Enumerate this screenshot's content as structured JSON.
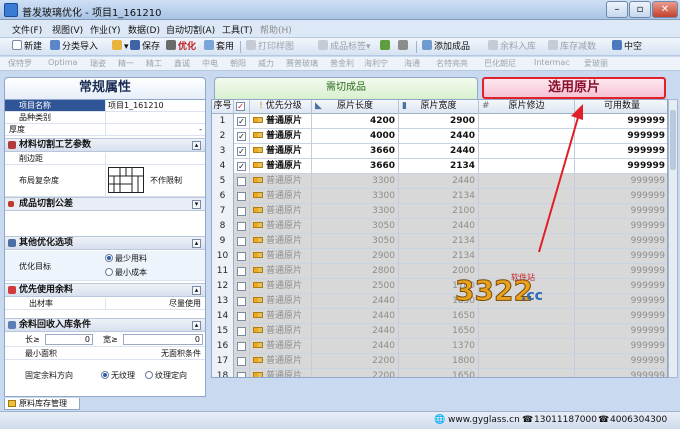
{
  "window": {
    "title": "普发玻璃优化 - 项目1_161210",
    "min": "–",
    "max": "▫",
    "close": "✕"
  },
  "menu": [
    "文件(F)",
    "视图(V)",
    "作业(Y)",
    "数据(D)",
    "自动切割(A)",
    "工具(T)",
    "帮助(H)"
  ],
  "toolbar": {
    "new": "新建",
    "import": "分类导入",
    "save": "保存",
    "optimize": "优化",
    "apply": "套用",
    "print": "打印样图",
    "label": "成品标签",
    "add": "添加成品",
    "inbound": "余料入库",
    "inventory": "库存减数",
    "hollow": "中空"
  },
  "brands": [
    "保特罗",
    "Optima",
    "瑞姿",
    "精一",
    "精工",
    "鑫诚",
    "中电",
    "朝阳",
    "威力",
    "赛普玻璃",
    "普金利",
    "海利宁",
    "海通",
    "名特亮亮",
    "巴化朗尼",
    "Intermac",
    "爱玻丽"
  ],
  "tabs": {
    "props": "常规属性",
    "cut": "需切成品",
    "select": "选用原片"
  },
  "left": {
    "project_name_label": "项目名称",
    "project_name_value": "项目1_161210",
    "category_label": "品种类别",
    "thickness_label": "厚度",
    "sec_cut_params": "材料切割工艺参数",
    "trim_label": "削边距",
    "complexity_label": "布局复杂度",
    "complexity_value": "不作限制",
    "sec_tolerance": "成品切割公差",
    "sec_other": "其他优化选项",
    "goal_label": "优化目标",
    "goal_opt1": "最少用料",
    "goal_opt2": "最小成本",
    "sec_remnant_first": "优先使用余料",
    "yield_label": "出材率",
    "yield_value": "尽量使用",
    "sec_remnant_in": "余料回收入库条件",
    "len_label": "长≥",
    "len_value": "0",
    "wid_label": "宽≥",
    "wid_value": "0",
    "minarea_label": "最小面积",
    "minarea_value": "无面积条件",
    "dir_label": "固定余料方向",
    "dir_opt1": "无纹理",
    "dir_opt2": "纹理定向"
  },
  "grid": {
    "headers": [
      "序号",
      "",
      "优先分级",
      "原片长度",
      "原片宽度",
      "原片修边",
      "可用数量"
    ],
    "rows": [
      {
        "n": "1",
        "checked": "✓",
        "grade": "普通原片",
        "len": "4200",
        "wid": "2900",
        "trim": "",
        "qty": "999999",
        "sel": true
      },
      {
        "n": "2",
        "checked": "✓",
        "grade": "普通原片",
        "len": "4000",
        "wid": "2440",
        "trim": "",
        "qty": "999999",
        "sel": true
      },
      {
        "n": "3",
        "checked": "✓",
        "grade": "普通原片",
        "len": "3660",
        "wid": "2440",
        "trim": "",
        "qty": "999999",
        "sel": true
      },
      {
        "n": "4",
        "checked": "✓",
        "grade": "普通原片",
        "len": "3660",
        "wid": "2134",
        "trim": "",
        "qty": "999999",
        "sel": true
      },
      {
        "n": "5",
        "checked": "",
        "grade": "普通原片",
        "len": "3300",
        "wid": "2440",
        "trim": "",
        "qty": "999999",
        "sel": false
      },
      {
        "n": "6",
        "checked": "",
        "grade": "普通原片",
        "len": "3300",
        "wid": "2134",
        "trim": "",
        "qty": "999999",
        "sel": false
      },
      {
        "n": "7",
        "checked": "",
        "grade": "普通原片",
        "len": "3300",
        "wid": "2100",
        "trim": "",
        "qty": "999999",
        "sel": false
      },
      {
        "n": "8",
        "checked": "",
        "grade": "普通原片",
        "len": "3050",
        "wid": "2440",
        "trim": "",
        "qty": "999999",
        "sel": false
      },
      {
        "n": "9",
        "checked": "",
        "grade": "普通原片",
        "len": "3050",
        "wid": "2134",
        "trim": "",
        "qty": "999999",
        "sel": false
      },
      {
        "n": "10",
        "checked": "",
        "grade": "普通原片",
        "len": "2900",
        "wid": "2134",
        "trim": "",
        "qty": "999999",
        "sel": false
      },
      {
        "n": "11",
        "checked": "",
        "grade": "普通原片",
        "len": "2800",
        "wid": "2000",
        "trim": "",
        "qty": "999999",
        "sel": false
      },
      {
        "n": "12",
        "checked": "",
        "grade": "普通原片",
        "len": "2500",
        "wid": "1700",
        "trim": "",
        "qty": "999999",
        "sel": false
      },
      {
        "n": "13",
        "checked": "",
        "grade": "普通原片",
        "len": "2440",
        "wid": "1830",
        "trim": "",
        "qty": "999999",
        "sel": false
      },
      {
        "n": "14",
        "checked": "",
        "grade": "普通原片",
        "len": "2440",
        "wid": "1650",
        "trim": "",
        "qty": "999999",
        "sel": false
      },
      {
        "n": "15",
        "checked": "",
        "grade": "普通原片",
        "len": "2440",
        "wid": "1650",
        "trim": "",
        "qty": "999999",
        "sel": false
      },
      {
        "n": "16",
        "checked": "",
        "grade": "普通原片",
        "len": "2440",
        "wid": "1370",
        "trim": "",
        "qty": "999999",
        "sel": false
      },
      {
        "n": "17",
        "checked": "",
        "grade": "普通原片",
        "len": "2200",
        "wid": "1800",
        "trim": "",
        "qty": "999999",
        "sel": false
      },
      {
        "n": "18",
        "checked": "",
        "grade": "普通原片",
        "len": "2200",
        "wid": "1650",
        "trim": "",
        "qty": "999999",
        "sel": false
      }
    ]
  },
  "bottom_tab": "原料库存管理",
  "status": {
    "website": "www.gyglass.cn",
    "phone1": "13011187000",
    "phone2": "4006304300"
  },
  "watermark": {
    "brand": "3322",
    "suffix": ".cc",
    "tag": "软件站"
  }
}
